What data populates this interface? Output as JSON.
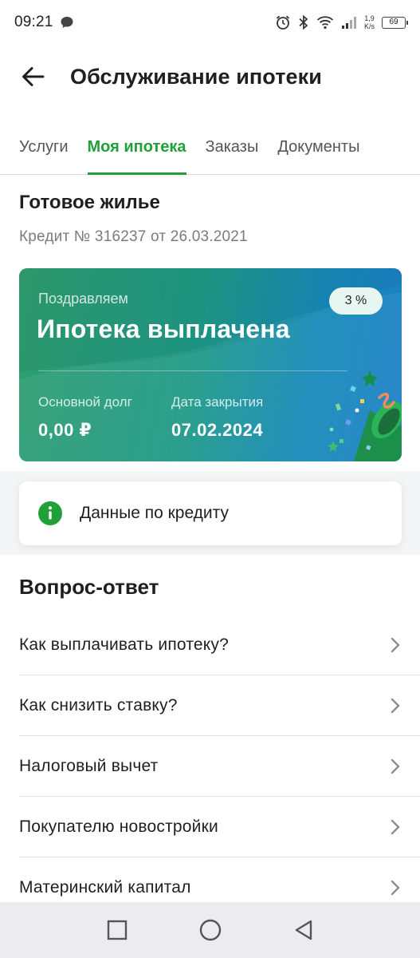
{
  "status_bar": {
    "time": "09:21",
    "net_speed_value": "1,9",
    "net_speed_unit": "K/s",
    "battery": "69",
    "icons": [
      "message-icon",
      "alarm-icon",
      "bluetooth-icon",
      "wifi-icon",
      "signal-icon",
      "battery-icon"
    ]
  },
  "header": {
    "title": "Обслуживание ипотеки"
  },
  "tabs": [
    {
      "label": "Услуги",
      "active": false
    },
    {
      "label": "Моя ипотека",
      "active": true
    },
    {
      "label": "Заказы",
      "active": false
    },
    {
      "label": "Документы",
      "active": false
    }
  ],
  "loan": {
    "title": "Готовое жилье",
    "credit_info": "Кредит № 316237 от 26.03.2021"
  },
  "card": {
    "greeting": "Поздравляем",
    "headline": "Ипотека выплачена",
    "rate": "3 %",
    "principal_label": "Основной долг",
    "principal_value": "0,00 ₽",
    "close_date_label": "Дата закрытия",
    "close_date_value": "07.02.2024",
    "colors": {
      "start": "#2f9e6f",
      "end": "#1c7fc7",
      "accent": "#21a038"
    }
  },
  "credit_data": {
    "label": "Данные по кредиту"
  },
  "faq": {
    "title": "Вопрос-ответ",
    "items": [
      "Как выплачивать ипотеку?",
      "Как снизить ставку?",
      "Налоговый вычет",
      "Покупателю новостройки",
      "Материнский капитал"
    ]
  },
  "nav_bar": {
    "buttons": [
      "recent-apps",
      "home",
      "back"
    ]
  }
}
